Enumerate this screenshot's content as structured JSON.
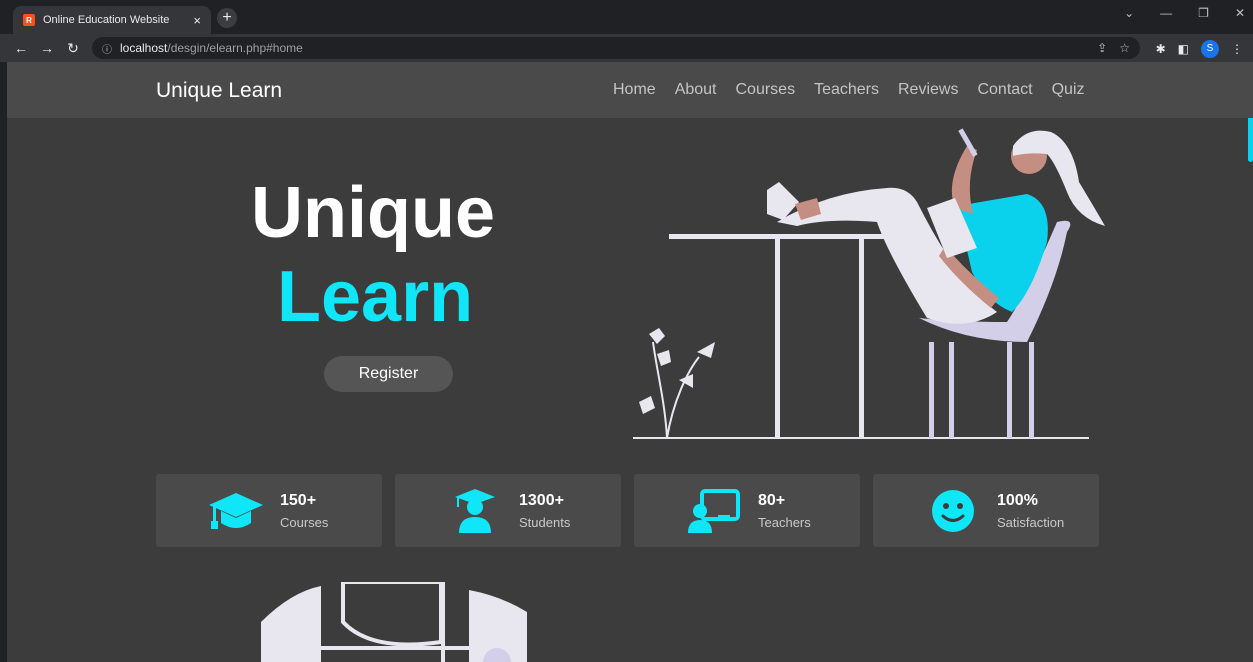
{
  "browser": {
    "tab_title": "Online Education Website",
    "tab_close": "×",
    "new_tab": "+",
    "favicon_letter": "R",
    "url_host": "localhost",
    "url_path": "/desgin/elearn.php#home",
    "profile_initial": "S",
    "window_controls": [
      "⌄",
      "—",
      "❐",
      "✕"
    ]
  },
  "site": {
    "logo": "Unique Learn",
    "nav": [
      "Home",
      "About",
      "Courses",
      "Teachers",
      "Reviews",
      "Contact",
      "Quiz"
    ]
  },
  "hero": {
    "title_line1": "Unique",
    "title_line2": "Learn",
    "register_label": "Register"
  },
  "stats": [
    {
      "value": "150+",
      "label": "Courses",
      "icon": "graduation-cap-icon"
    },
    {
      "value": "1300+",
      "label": "Students",
      "icon": "student-icon"
    },
    {
      "value": "80+",
      "label": "Teachers",
      "icon": "teacher-board-icon"
    },
    {
      "value": "100%",
      "label": "Satisfaction",
      "icon": "smiley-icon"
    }
  ],
  "colors": {
    "accent": "#0fe6f7",
    "page_bg": "#3c3c3c",
    "header_bg": "#4a4a4a",
    "card_bg": "#4a4a4a"
  }
}
